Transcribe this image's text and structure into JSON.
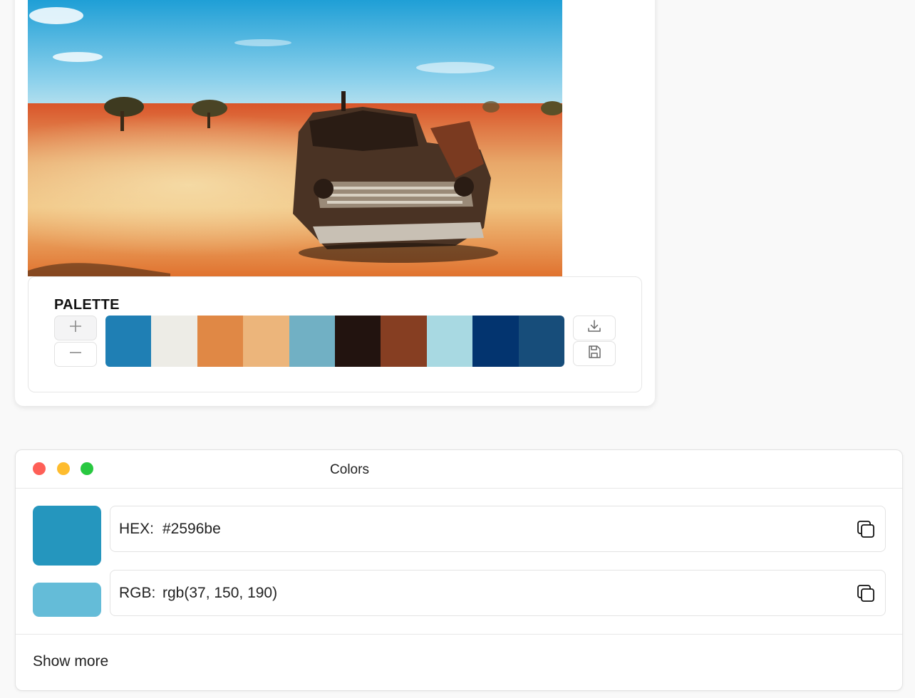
{
  "palette": {
    "title": "PALETTE",
    "add_icon": "plus-icon",
    "remove_icon": "minus-icon",
    "download_icon": "download-icon",
    "save_icon": "save-icon",
    "swatches": [
      "#1f7fb4",
      "#edece6",
      "#e08845",
      "#ecb57b",
      "#71b0c4",
      "#22130f",
      "#863e22",
      "#a8d9e2",
      "#03346f",
      "#174d7a"
    ]
  },
  "colors_window": {
    "title": "Colors",
    "traffic_lights": {
      "close": "#fe5f57",
      "minimize": "#febc2e",
      "maximize": "#28c840"
    },
    "primary_swatch": "#2596be",
    "secondary_swatch": "#64bcd8",
    "hex_label": "HEX:",
    "hex_value": "#2596be",
    "rgb_label": "RGB:",
    "rgb_value": "rgb(37, 150, 190)",
    "copy_icon": "copy-icon",
    "show_more": "Show more"
  }
}
